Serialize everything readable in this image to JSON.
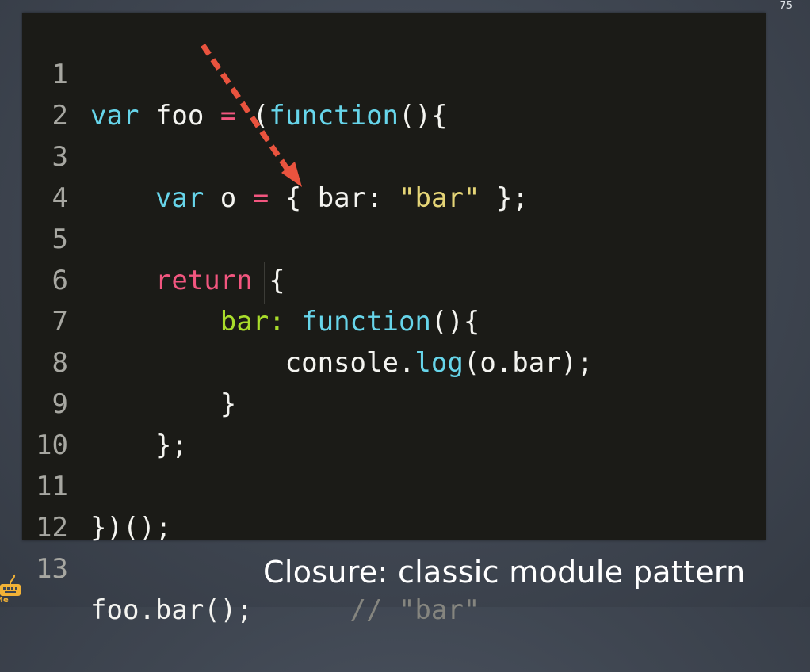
{
  "slide": {
    "number": "75",
    "caption": "Closure: classic module pattern",
    "logo_text": "Me",
    "annotation": {
      "type": "dashed-arrow",
      "color": "#e9533e"
    }
  },
  "code": {
    "lines": [
      {
        "n": "1",
        "text": "var foo = (function(){"
      },
      {
        "n": "2",
        "text": ""
      },
      {
        "n": "3",
        "text": "    var o = { bar: \"bar\" };"
      },
      {
        "n": "4",
        "text": ""
      },
      {
        "n": "5",
        "text": "    return {"
      },
      {
        "n": "6",
        "text": "        bar: function(){"
      },
      {
        "n": "7",
        "text": "            console.log(o.bar);"
      },
      {
        "n": "8",
        "text": "        }"
      },
      {
        "n": "9",
        "text": "    };"
      },
      {
        "n": "10",
        "text": ""
      },
      {
        "n": "11",
        "text": "})();"
      },
      {
        "n": "12",
        "text": ""
      },
      {
        "n": "13",
        "text": "foo.bar();      // \"bar\""
      }
    ],
    "tokens": {
      "var": "var",
      "foo": "foo",
      "equals": "=",
      "function_open": "(function(){",
      "paren_open": "(",
      "function": "function",
      "paren_close_brace": "(){",
      "o_decl": "o",
      "brace_open": "{",
      "bar_prop": "bar:",
      "bar_string": "\"bar\"",
      "object_close": "};",
      "return": "return",
      "return_brace": "{",
      "function_decl": "function",
      "function_tail": "(){",
      "console": "console",
      "dot": ".",
      "log": "log",
      "log_args": "(o.bar);",
      "inner_close": "}",
      "return_close": "};",
      "iife_close": "})();",
      "foo_call": "foo.bar();",
      "comment": "// \"bar\""
    }
  },
  "colors": {
    "background": "#3f4651",
    "code_background": "#1b1b17",
    "keyword_blue": "#67d5ea",
    "keyword_pink": "#f2567f",
    "property_green": "#a9dd2b",
    "string_yellow": "#e5d577",
    "comment_gray": "#85857f",
    "arrow_red": "#e9533e"
  },
  "icons": {
    "logo": "keyboard-logo-icon"
  }
}
